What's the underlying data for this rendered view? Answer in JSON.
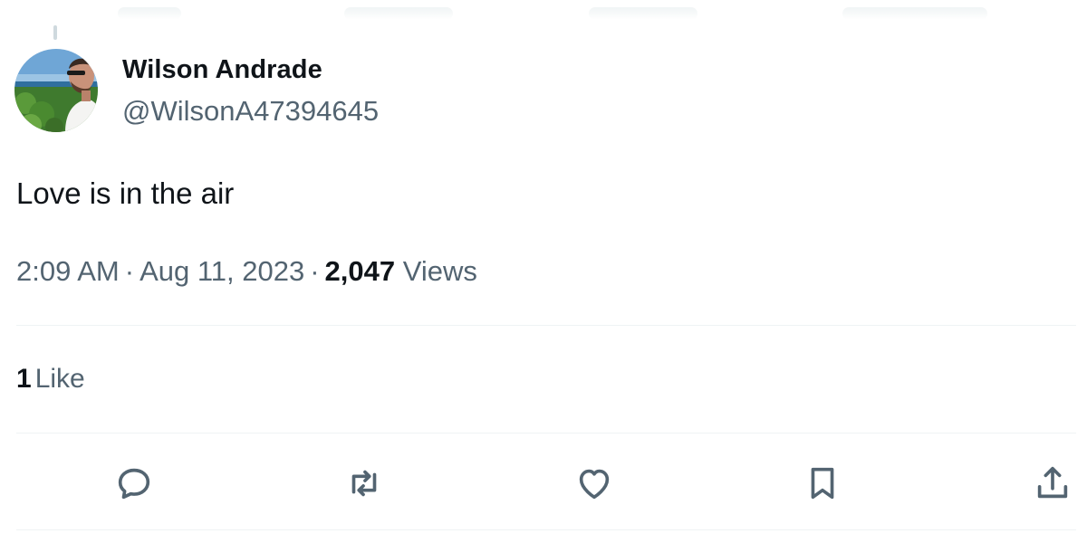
{
  "tweet": {
    "display_name": "Wilson Andrade",
    "handle": "@WilsonA47394645",
    "text": "Love is in the air",
    "time": "2:09 AM",
    "date": "Aug 11, 2023",
    "separator": "·",
    "views_count": "2,047",
    "views_label": "Views"
  },
  "engagement": {
    "likes_count": "1",
    "likes_label": "Like"
  },
  "actions": [
    {
      "name": "reply",
      "icon": "reply-icon"
    },
    {
      "name": "retweet",
      "icon": "retweet-icon"
    },
    {
      "name": "like",
      "icon": "heart-icon"
    },
    {
      "name": "bookmark",
      "icon": "bookmark-icon"
    },
    {
      "name": "share",
      "icon": "share-icon"
    }
  ],
  "colors": {
    "text_primary": "#0f1419",
    "text_secondary": "#536471",
    "divider": "#eff3f4"
  }
}
